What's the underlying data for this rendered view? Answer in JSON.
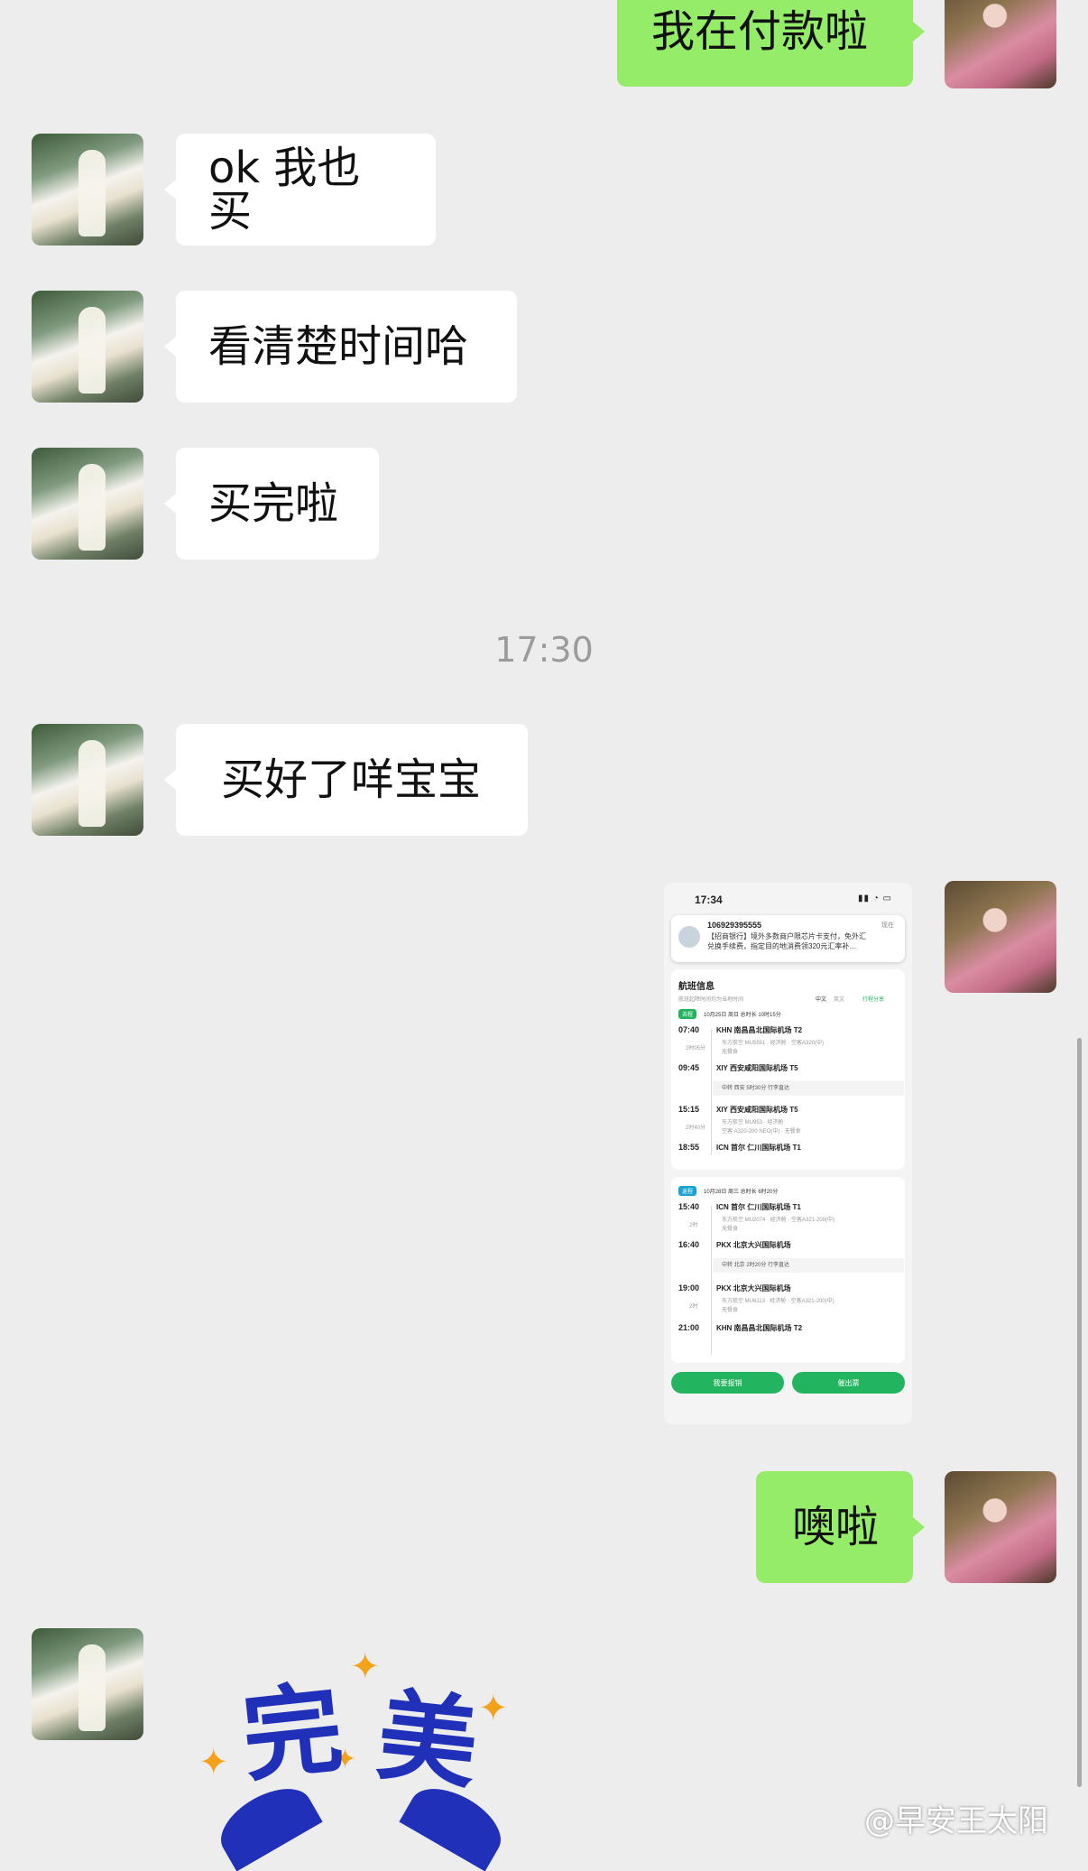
{
  "messages": {
    "m1": "我在付款啦",
    "m2": "ok 我也买",
    "m3": "看清楚时间哈",
    "m4": "买完啦",
    "time1": "17:30",
    "m5": "买好了咩宝宝",
    "m6": "噢啦"
  },
  "screenshot": {
    "status_time": "17:34",
    "notif_sender": "106929395555",
    "notif_now": "现在",
    "notif_text_1": "【招商银行】境外多数商户限芯片卡支付，免外汇",
    "notif_text_2": "兑换手续费，指定目的地消费领320元汇率补…",
    "section_title": "航班信息",
    "section_sub": "航班起降时间均为当地时间",
    "lang_zh": "中文",
    "lang_en": "英文",
    "share": "行程分享",
    "outbound": {
      "tag": "去程",
      "info": "10月25日 周日   总时长 10时15分",
      "seg1_dep_time": "07:40",
      "seg1_dep": "KHN 南昌昌北国际机场 T2",
      "seg1_flight": "东方航空 MU5551 · 经济舱 · 空客A320(中)",
      "seg1_meal": "无餐食",
      "seg1_dur": "2时05分",
      "seg1_arr_time": "09:45",
      "seg1_arr": "XIY 西安咸阳国际机场 T5",
      "transfer": "中转 西安 5时30分   行李直达",
      "seg2_dep_time": "15:15",
      "seg2_dep": "XIY 西安咸阳国际机场 T5",
      "seg2_flight": "东方航空 MU953 · 经济舱",
      "seg2_flight2": "空客 A320-200 NEO(中) · 无餐食",
      "seg2_dur": "2时40分",
      "seg2_arr_time": "18:55",
      "seg2_arr": "ICN 首尔 仁川国际机场 T1"
    },
    "return": {
      "tag": "返程",
      "info": "10月28日 周三   总时长 6时20分",
      "seg1_dep_time": "15:40",
      "seg1_dep": "ICN 首尔 仁川国际机场 T1",
      "seg1_flight": "东方航空 MU2074 · 经济舱 · 空客A321-200(中)",
      "seg1_meal": "无餐食",
      "seg1_dur": "2时",
      "seg1_arr_time": "16:40",
      "seg1_arr": "PKX 北京大兴国际机场",
      "transfer": "中转 北京 2时20分   行李直达",
      "seg2_dep_time": "19:00",
      "seg2_dep": "PKX 北京大兴国际机场",
      "seg2_flight": "东方航空 MU6113 · 经济舱 · 空客A321-200(中)",
      "seg2_meal": "无餐食",
      "seg2_dur": "2时",
      "seg2_arr_time": "21:00",
      "seg2_arr": "KHN 南昌昌北国际机场 T2"
    },
    "btn_left": "我要报销",
    "btn_right": "催出票"
  },
  "sticker": {
    "char1": "完",
    "char2": "美"
  },
  "watermark": "@早安王太阳",
  "colors": {
    "background": "#ededed",
    "outgoing_bubble": "#95ec69",
    "incoming_bubble": "#ffffff",
    "timestamp": "#9b9b9b",
    "sticker_blue": "#2030b8",
    "sticker_sparkle": "#f3a21a",
    "app_green": "#23b45f"
  }
}
